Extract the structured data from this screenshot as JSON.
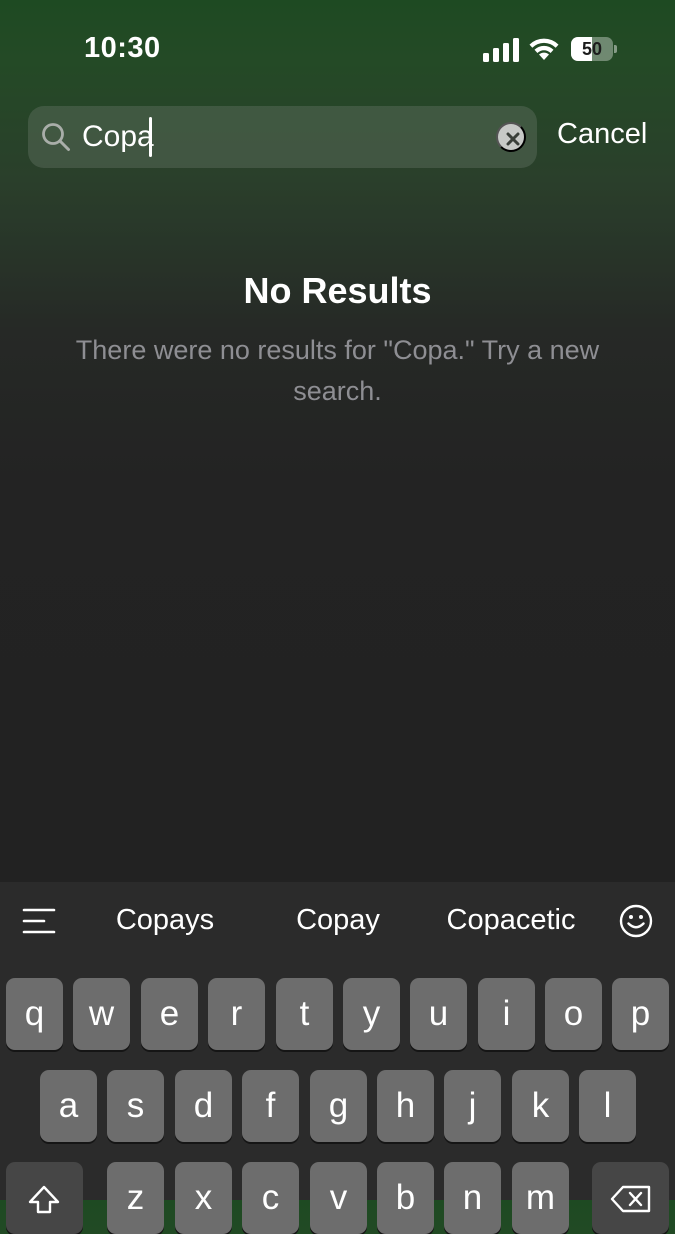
{
  "status_bar": {
    "time": "10:30",
    "battery_level": "50",
    "battery_percent": 50
  },
  "search": {
    "query": "Copa",
    "cancel_label": "Cancel"
  },
  "results": {
    "title": "No Results",
    "message": "There were no results for \"Copa.\" Try a new search."
  },
  "keyboard": {
    "suggestions": [
      "Copays",
      "Copay",
      "Copacetic"
    ],
    "row1": [
      "q",
      "w",
      "e",
      "r",
      "t",
      "y",
      "u",
      "i",
      "o",
      "p"
    ],
    "row2": [
      "a",
      "s",
      "d",
      "f",
      "g",
      "h",
      "j",
      "k",
      "l"
    ],
    "row3": [
      "z",
      "x",
      "c",
      "v",
      "b",
      "n",
      "m"
    ]
  },
  "colors": {
    "accent_text": "#ffffff",
    "secondary_text": "#8e8e93",
    "key_bg": "#6d6d6d",
    "keyboard_bg": "#2b2b2b"
  }
}
